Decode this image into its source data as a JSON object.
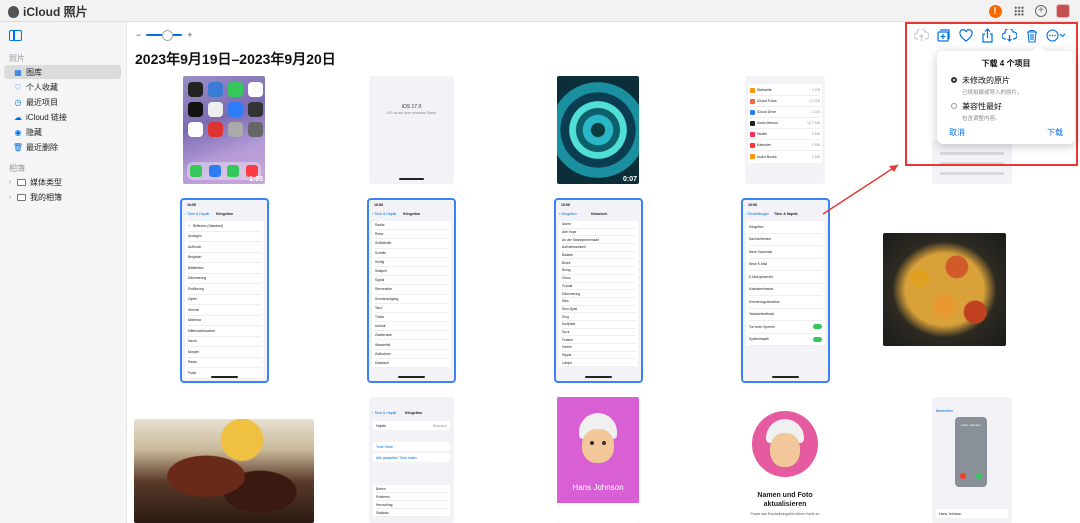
{
  "app": {
    "title": "iCloud 照片",
    "notification_count": "!"
  },
  "sidebar": {
    "section_photos": "照片",
    "items": [
      {
        "label": "图库",
        "icon": "library-icon",
        "active": true
      },
      {
        "label": "个人收藏",
        "icon": "heart-icon"
      },
      {
        "label": "最近项目",
        "icon": "clock-icon"
      },
      {
        "label": "iCloud 链接",
        "icon": "link-icon"
      },
      {
        "label": "隐藏",
        "icon": "eye-slash-icon"
      },
      {
        "label": "最近删除",
        "icon": "trash-icon"
      }
    ],
    "section_albums": "相簿",
    "albums": [
      {
        "label": "媒体类型"
      },
      {
        "label": "我的相簿"
      }
    ]
  },
  "main": {
    "zoom_minus": "−",
    "zoom_plus": "+",
    "date_range": "2023年9月19日–2023年9月20日"
  },
  "toolbar": {
    "icons": [
      "upload-icon",
      "add-to-album-icon",
      "favorite-icon",
      "share-icon",
      "download-icon",
      "delete-icon",
      "more-icon"
    ]
  },
  "download_popover": {
    "title": "下载 4 个项目",
    "options": [
      {
        "title": "未修改的原片",
        "subtitle": "已续拍摄或导入的原片。",
        "selected": true
      },
      {
        "title": "兼容性最好",
        "subtitle": "包含调整内容。",
        "selected": false
      }
    ],
    "cancel": "取消",
    "confirm": "下载"
  },
  "tiles": {
    "video1_duration": "1:05",
    "video2_duration": "0:07",
    "ios_title": "iOS 17.0",
    "ios_sub": "iOS ist auf dem neuesten Stand",
    "settings_rows": [
      {
        "name": "Startseite",
        "size": "2 GB"
      },
      {
        "name": "iCloud Fotos",
        "size": "1,3 GB"
      },
      {
        "name": "iCloud Drive",
        "size": "1 GB"
      },
      {
        "name": "Voice Memos",
        "size": "12,7 MB"
      },
      {
        "name": "Health",
        "size": "5 MB"
      },
      {
        "name": "Kalender",
        "size": "2 MB"
      },
      {
        "name": "Audio Books",
        "size": "2 MB"
      }
    ],
    "ringtone_header": "Klingelton",
    "ringtone_back": "Töne & Haptik",
    "ringtone_time": "16:58",
    "ringtones": [
      "Reflexion (Standard)",
      "Anzeigen",
      "Aufbruch",
      "Bergfahrt",
      "Blättertanz",
      "Dämmerung",
      "Einführung",
      "Gipfel",
      "Himmel",
      "Marimba",
      "Mitternachtswalzer",
      "Nacht",
      "Morgen",
      "Radar",
      "Pulse"
    ],
    "ringtone2_list": [
      "Radial",
      "Reise",
      "Schildkröte",
      "Schritte",
      "Seidig",
      "Skalpell",
      "Signal",
      "Sternenklar",
      "Sonnenaufgang",
      "Tanz",
      "Türkis",
      "Umlauf",
      "Zauberstab",
      "Wasserfall",
      "Zwitschern",
      "Klassisch"
    ],
    "classic_header": "Klassisch",
    "classic_back": "Klingelton",
    "classic_list": [
      "Alarm",
      "Alte Hupe",
      "An der Strandpromenade",
      "Aufmerksamkeit",
      "Ballade",
      "Blues",
      "Boing",
      "Cirrus",
      "Crystal",
      "Dämmerung",
      "Dibs",
      "Dino-Spiel",
      "Ding",
      "Dorfplatz",
      "Duck",
      "Funken",
      "Harfen",
      "Hippie",
      "Lampe"
    ],
    "sounds_header": "Töne & Haptik",
    "sounds_back": "Einstellungen",
    "sounds_rows": [
      "Klingelton",
      "Nachrichtenton",
      "Neue Voicemail",
      "Neue E-Mail",
      "E-Mail gesendet",
      "Kalenderhinweis",
      "Erinnerungshinweise",
      "Tastaturfeedback",
      "Ton beim Sperren",
      "Systemhaptik"
    ],
    "contact_name": "Hans Johnson",
    "memoji_title": "Namen und Foto aktualisieren",
    "memoji_desc": "Passe das Erscheinungsbild deiner Karte an",
    "haptik_label": "Haptik",
    "haptik_value": "Standard",
    "tone_store": "Tone Store",
    "tone_redownload": "Alle gekauften Töne laden",
    "haptik_list": [
      "Beben",
      "Pulsieren",
      "Herzschlag",
      "Stakkato"
    ],
    "call_name": "Hans Johnson",
    "call_side": "Bearbeiten"
  }
}
